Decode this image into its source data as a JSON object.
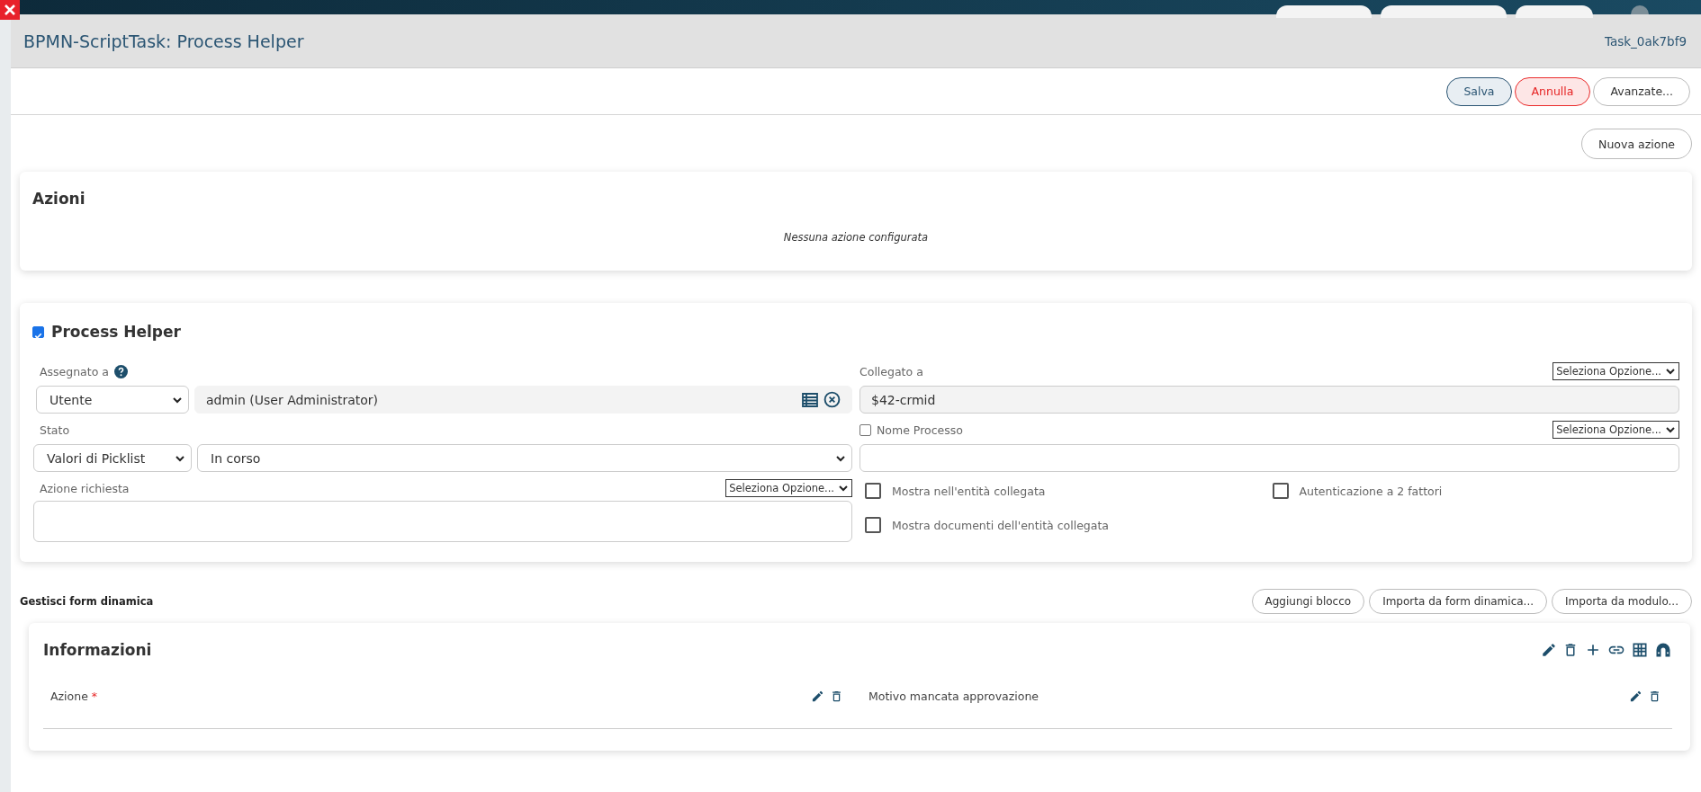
{
  "window": {
    "title": "BPMN-ScriptTask: Process Helper",
    "task_id": "Task_0ak7bf9"
  },
  "toolbar": {
    "buttons": [
      {
        "label": "Salva",
        "kind": "primary"
      },
      {
        "label": "Annulla",
        "kind": "danger"
      },
      {
        "label": "Avanzate...",
        "kind": "default"
      }
    ]
  },
  "actions": {
    "new_button": "Nuova azione",
    "title": "Azioni",
    "empty_message": "Nessuna azione configurata"
  },
  "process_helper": {
    "title": "Process Helper",
    "checked": true,
    "assigned": {
      "label": "Assegnato a",
      "type_value": "Utente",
      "value": "admin (User Administrator)"
    },
    "status": {
      "label": "Stato",
      "type_value": "Valori di Picklist",
      "value": "In corso"
    },
    "required_action": {
      "label": "Azione richiesta",
      "option_select": "Seleziona Opzione..."
    },
    "linked": {
      "label": "Collegato a",
      "option_select": "Seleziona Opzione...",
      "value": "$42-crmid"
    },
    "process_name": {
      "label": "Nome Processo",
      "checked": false,
      "option_select": "Seleziona Opzione..."
    },
    "options": [
      {
        "label": "Mostra nell'entità collegata",
        "checked": false
      },
      {
        "label": "Autenticazione a 2 fattori",
        "checked": false
      },
      {
        "label": "Mostra documenti dell'entità collegata",
        "checked": false
      }
    ]
  },
  "dynamic_form": {
    "title": "Gestisci form dinamica",
    "buttons": [
      "Aggiungi blocco",
      "Importa da form dinamica...",
      "Importa da modulo..."
    ],
    "block": {
      "title": "Informazioni",
      "fields": [
        {
          "label": "Azione",
          "mark": "*"
        },
        {
          "label": "Motivo mancata approvazione"
        }
      ]
    }
  }
}
